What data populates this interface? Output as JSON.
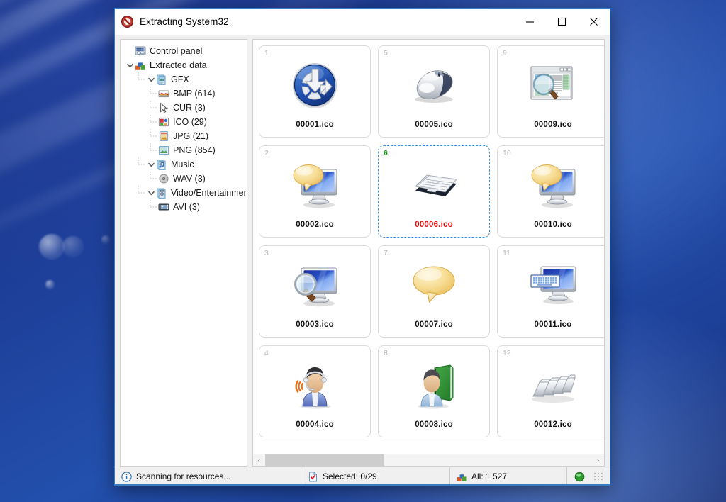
{
  "window": {
    "title": "Extracting System32",
    "title_icon": "stop-sign-icon",
    "minimize_label": "Minimize",
    "maximize_label": "Maximize",
    "close_label": "Close"
  },
  "tree": {
    "nodes": [
      {
        "label": "Control panel",
        "depth": 0,
        "expander": "none",
        "icon": "control-panel-icon"
      },
      {
        "label": "Extracted data",
        "depth": 0,
        "expander": "expanded",
        "icon": "blocks-icon"
      },
      {
        "label": "GFX",
        "depth": 1,
        "expander": "expanded",
        "icon": "images-folder-icon"
      },
      {
        "label": "BMP (614)",
        "depth": 2,
        "expander": "none",
        "icon": "bmp-file-icon"
      },
      {
        "label": "CUR (3)",
        "depth": 2,
        "expander": "none",
        "icon": "cursor-icon"
      },
      {
        "label": "ICO (29)",
        "depth": 2,
        "expander": "none",
        "icon": "ico-file-icon"
      },
      {
        "label": "JPG (21)",
        "depth": 2,
        "expander": "none",
        "icon": "jpg-file-icon"
      },
      {
        "label": "PNG (854)",
        "depth": 2,
        "expander": "none",
        "icon": "png-file-icon"
      },
      {
        "label": "Music",
        "depth": 1,
        "expander": "expanded",
        "icon": "music-folder-icon"
      },
      {
        "label": "WAV (3)",
        "depth": 2,
        "expander": "none",
        "icon": "wav-file-icon"
      },
      {
        "label": "Video/Entertainment",
        "depth": 1,
        "expander": "expanded",
        "icon": "video-folder-icon"
      },
      {
        "label": "AVI (3)",
        "depth": 2,
        "expander": "none",
        "icon": "avi-file-icon"
      }
    ]
  },
  "grid": {
    "items": [
      {
        "num": "1",
        "label": "00001.ico",
        "art": "download-badge",
        "selected": false
      },
      {
        "num": "5",
        "label": "00005.ico",
        "art": "mouse",
        "selected": false
      },
      {
        "num": "9",
        "label": "00009.ico",
        "art": "window-search",
        "selected": false
      },
      {
        "num": "2",
        "label": "00002.ico",
        "art": "monitor-bubble",
        "selected": false
      },
      {
        "num": "6",
        "label": "00006.ico",
        "art": "keyboard-flat",
        "selected": true
      },
      {
        "num": "10",
        "label": "00010.ico",
        "art": "monitor-bubble",
        "selected": false
      },
      {
        "num": "3",
        "label": "00003.ico",
        "art": "monitor-magnify",
        "selected": false
      },
      {
        "num": "7",
        "label": "00007.ico",
        "art": "speech-bubble",
        "selected": false
      },
      {
        "num": "11",
        "label": "00011.ico",
        "art": "monitor-keyboard",
        "selected": false
      },
      {
        "num": "4",
        "label": "00004.ico",
        "art": "user-headset",
        "selected": false
      },
      {
        "num": "8",
        "label": "00008.ico",
        "art": "user-book",
        "selected": false
      },
      {
        "num": "12",
        "label": "00012.ico",
        "art": "keycaps",
        "selected": false
      }
    ],
    "scroll_left_label": "‹",
    "scroll_right_label": "›"
  },
  "statusbar": {
    "status_text": "Scanning for resources...",
    "status_icon": "info-icon",
    "selected_text": "Selected: 0/29",
    "selected_icon": "checked-document-icon",
    "all_text": "All: 1 527",
    "all_icon": "blocks-icon",
    "indicator_icon": "green-led-icon"
  },
  "colors": {
    "accent": "#3a7cc4",
    "selection_border": "#3b8fe0",
    "selected_label": "#e01010",
    "selected_number": "#15a015",
    "desktop_blue": "#1c3c95"
  }
}
